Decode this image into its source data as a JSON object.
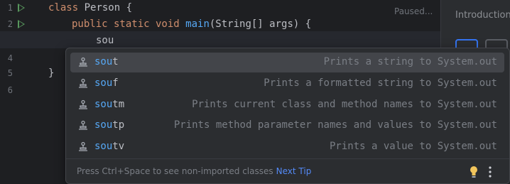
{
  "editor": {
    "line_numbers": [
      "1",
      "2",
      "3",
      "4",
      "5",
      "6"
    ],
    "code": {
      "line1": {
        "kw": "class",
        "text": " Person {"
      },
      "line2": {
        "kw": "public static void",
        "fn": "main",
        "text": "(String[] args) {"
      },
      "line3": {
        "text": "sou"
      },
      "line5": {
        "text": "}"
      }
    },
    "status": "Paused..."
  },
  "right_panel": {
    "title": "Introduction"
  },
  "completion": {
    "items": [
      {
        "match": "sou",
        "rest": "t",
        "description": "Prints a string to System.out",
        "icon": "live-template-icon"
      },
      {
        "match": "sou",
        "rest": "f",
        "description": "Prints a formatted string to System.out",
        "icon": "live-template-icon"
      },
      {
        "match": "sou",
        "rest": "tm",
        "description": "Prints current class and method names to System.out",
        "icon": "live-template-icon"
      },
      {
        "match": "sou",
        "rest": "tp",
        "description": "Prints method parameter names and values to System.out",
        "icon": "live-template-icon"
      },
      {
        "match": "sou",
        "rest": "tv",
        "description": "Prints a value to System.out",
        "icon": "live-template-icon"
      }
    ],
    "selected_index": 0,
    "footer": {
      "hint": "Press Ctrl+Space to see non-imported classes",
      "next_tip": "Next Tip"
    }
  },
  "colors": {
    "background": "#1e1f22",
    "keyword": "#cf8e6d",
    "function": "#56a8f5",
    "run": "#57965c",
    "accent": "#3574f0"
  }
}
